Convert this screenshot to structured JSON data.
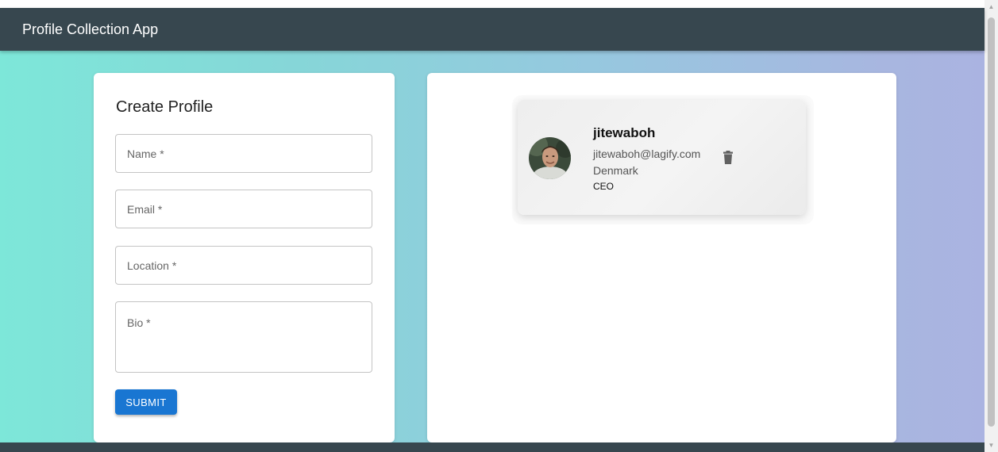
{
  "appbar": {
    "title": "Profile Collection App"
  },
  "form": {
    "title": "Create Profile",
    "fields": {
      "name": "Name *",
      "email": "Email *",
      "location": "Location *",
      "bio": "Bio *"
    },
    "submit_label": "SUBMIT"
  },
  "profiles": [
    {
      "name": "jitewaboh",
      "email": "jitewaboh@lagify.com",
      "location": "Denmark",
      "role": "CEO",
      "delete_icon": "trash-icon"
    }
  ],
  "colors": {
    "appbar": "#37474f",
    "primary": "#1976d2",
    "gradient_start": "#7de7d9",
    "gradient_end": "#aab3e1"
  }
}
